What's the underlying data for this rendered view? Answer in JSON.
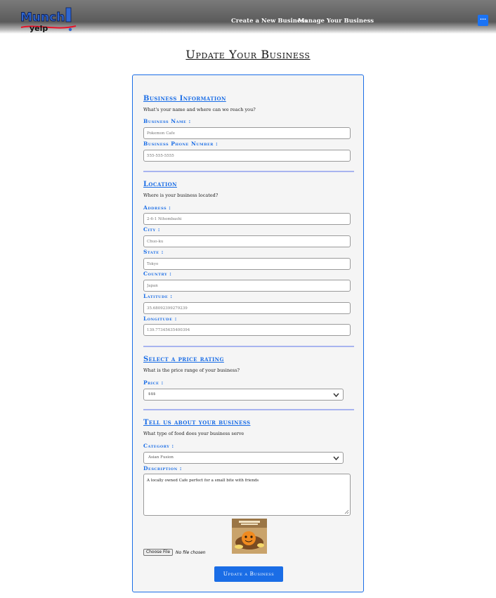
{
  "brand": {
    "logo_word_top": "Munch",
    "logo_word_bottom": "yelp",
    "colors": {
      "primary": "#1a6de6",
      "divider": "#a8b4ef",
      "logo_red": "#e8132a"
    }
  },
  "nav": {
    "create_label": "Create a New Business",
    "manage_label": "Manage Your Business",
    "menu_icon": "ellipsis-icon",
    "menu_label": "···"
  },
  "page": {
    "title": "Update Your Business"
  },
  "form": {
    "info": {
      "heading": "Business Information",
      "description": "What's your name and where can we reach you?",
      "name_label": "Business Name :",
      "name_value": "Pokemon Cafe",
      "phone_label": "Business Phone Number :",
      "phone_placeholder": "555-555-5555"
    },
    "location": {
      "heading": "Location",
      "description": "Where is your business located?",
      "address_label": "Address :",
      "address_value": "2-6-1 Nihombashi",
      "city_label": "City :",
      "city_value": "Chuo-ku",
      "state_label": "State :",
      "state_value": "Tokyo",
      "country_label": "Country :",
      "country_value": "Japan",
      "latitude_label": "Latitude :",
      "latitude_value": "35.68092399279239",
      "longitude_label": "Longitude :",
      "longitude_value": "139.77345635400394"
    },
    "price": {
      "heading": "Select a price rating",
      "description": "What is the price range of your business?",
      "price_label": "Price :",
      "price_value": "$$$"
    },
    "about": {
      "heading": "Tell us about your business",
      "description": "What type of food does your business serve",
      "category_label": "Category :",
      "category_value": "Asian Fusion",
      "description_label": "Description :",
      "description_value": "A locally owned Cafe perfect for a small bite with friends"
    },
    "upload": {
      "choose_label": "Choose File",
      "status_text": "No file chosen",
      "thumb_caption": "Charmander Cheesy Cafe Platter"
    },
    "submit_label": "Update a Business"
  }
}
